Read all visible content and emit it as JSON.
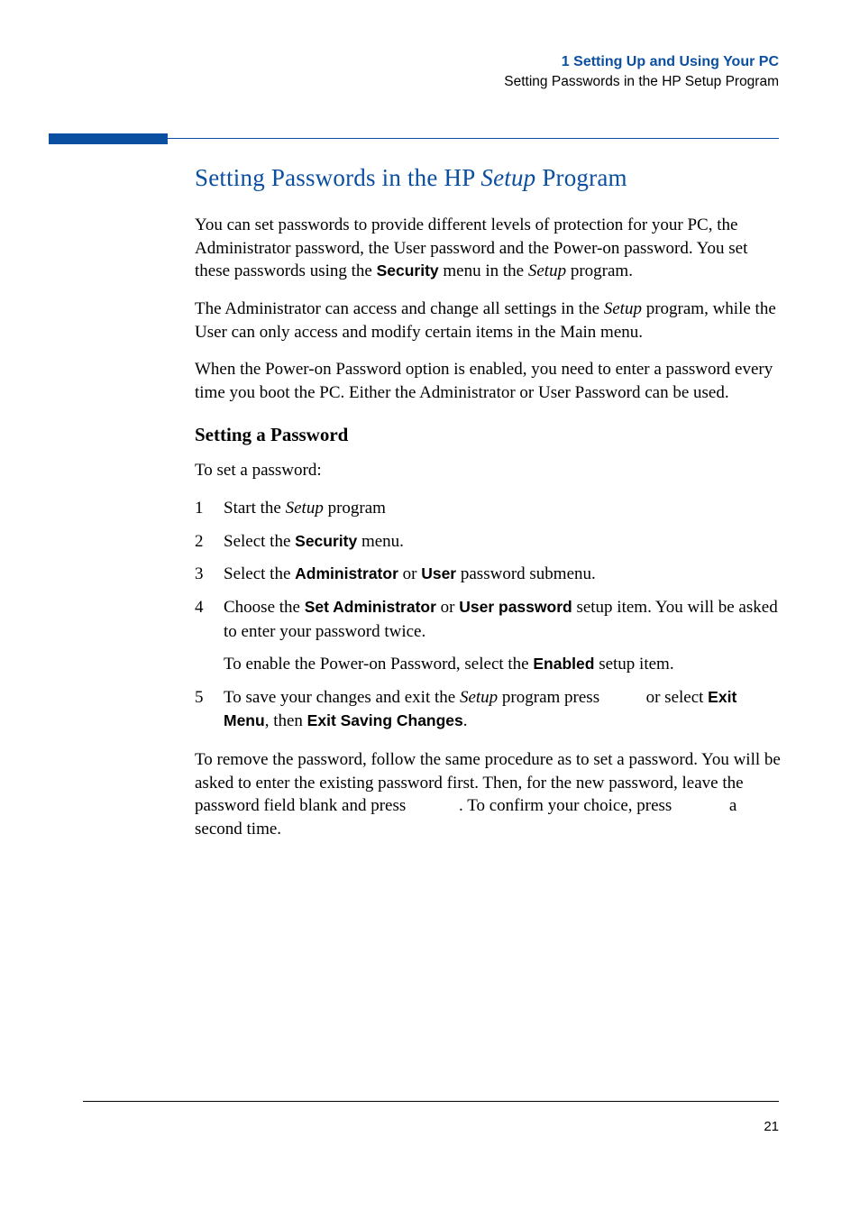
{
  "header": {
    "chapter": "1   Setting Up and Using Your PC",
    "subtitle": "Setting Passwords in the HP Setup Program"
  },
  "heading": {
    "pre": "Setting Passwords in the HP ",
    "italic": "Setup",
    "post": " Program"
  },
  "p1": {
    "a": "You can set passwords to provide different levels of protection for your PC, the Administrator password, the User password and the Power-on password. You set these passwords using the ",
    "b": "Security",
    "c": " menu in the ",
    "d": "Setup",
    "e": " program."
  },
  "p2": {
    "a": "The Administrator can access and change all settings in the ",
    "b": "Setup",
    "c": " program, while the User can only access and modify certain items in the Main menu."
  },
  "p3": "When the Power-on Password option is enabled, you need to enter a password every time you boot the PC. Either the Administrator or User Password can be used.",
  "sub_heading": "Setting a Password",
  "intro": "To set a password:",
  "steps": {
    "s1": {
      "num": "1",
      "a": "Start the ",
      "b": "Setup",
      "c": " program"
    },
    "s2": {
      "num": "2",
      "a": "Select the ",
      "b": "Security",
      "c": " menu."
    },
    "s3": {
      "num": "3",
      "a": "Select the ",
      "b": "Administrator",
      "c": " or ",
      "d": "User",
      "e": " password submenu."
    },
    "s4": {
      "num": "4",
      "a": "Choose the ",
      "b": "Set Administrator",
      "c": " or ",
      "d": "User password",
      "e": " setup item. You will be asked to enter your password twice.",
      "sub_a": "To enable the Power-on Password, select the ",
      "sub_b": "Enabled",
      "sub_c": " setup item."
    },
    "s5": {
      "num": "5",
      "a": "To save your changes and exit the ",
      "b": "Setup",
      "c": " program press ",
      "d": " or select ",
      "e": "Exit Menu",
      "f": ", then ",
      "g": "Exit Saving Changes",
      "h": "."
    }
  },
  "p_final": {
    "a": "To remove the password, follow the same procedure as to set a password. You will be asked to enter the existing password first. Then, for the new password, leave the password field blank and press ",
    "b": ". To confirm your choice, press ",
    "c": " a second time."
  },
  "page_number": "21"
}
